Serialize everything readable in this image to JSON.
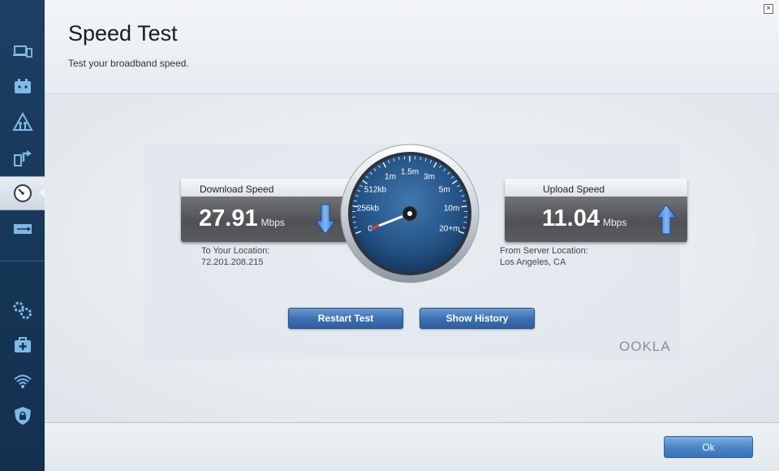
{
  "header": {
    "title": "Speed Test",
    "subtitle": "Test your broadband speed.",
    "close_label": "×"
  },
  "sidebar": {
    "items": [
      {
        "icon": "devices-icon"
      },
      {
        "icon": "router-settings-icon"
      },
      {
        "icon": "alert-triangle-icon"
      },
      {
        "icon": "media-prioritization-icon"
      },
      {
        "icon": "speedometer-icon",
        "active": true
      },
      {
        "icon": "usb-storage-icon"
      },
      {
        "icon": "gears-icon"
      },
      {
        "icon": "troubleshooting-kit-icon"
      },
      {
        "icon": "wifi-settings-icon"
      },
      {
        "icon": "security-shield-icon"
      }
    ]
  },
  "download": {
    "label": "Download Speed",
    "value": "27.91",
    "unit": "Mbps",
    "location_label": "To Your Location:",
    "location_value": "72.201.208.215"
  },
  "upload": {
    "label": "Upload Speed",
    "value": "11.04",
    "unit": "Mbps",
    "location_label": "From Server Location:",
    "location_value": "Los Angeles, CA"
  },
  "gauge": {
    "labels": [
      "0",
      "256kb",
      "512kb",
      "1m",
      "1.5m",
      "3m",
      "5m",
      "10m",
      "20+m"
    ]
  },
  "buttons": {
    "restart": "Restart Test",
    "history": "Show History",
    "ok": "Ok"
  },
  "branding": {
    "logo": "OOKLA"
  },
  "colors": {
    "sidebar": "#1a3a5c",
    "accent_blue": "#3d71b4",
    "gauge_face": "#2b5f93"
  }
}
